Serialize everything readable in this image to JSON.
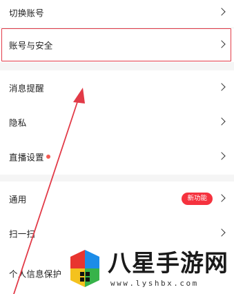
{
  "settings": {
    "group1": [
      {
        "label": "切换账号"
      },
      {
        "label": "账号与安全"
      }
    ],
    "group2": [
      {
        "label": "消息提醒"
      },
      {
        "label": "隐私"
      },
      {
        "label": "直播设置"
      }
    ],
    "group3": [
      {
        "label": "通用",
        "badge": "新功能"
      },
      {
        "label": "扫一扫"
      },
      {
        "label": "个人信息保护"
      }
    ]
  },
  "annotation": {
    "highlight_color": "#e23a47",
    "arrow_color": "#e23a47"
  },
  "colors": {
    "background": "#f5f5f5",
    "row_background": "#ffffff",
    "dot": "#f25a52",
    "badge": "#f5323e"
  },
  "watermark": {
    "title": "八星手游网",
    "url": "www.lyshbx.com"
  }
}
